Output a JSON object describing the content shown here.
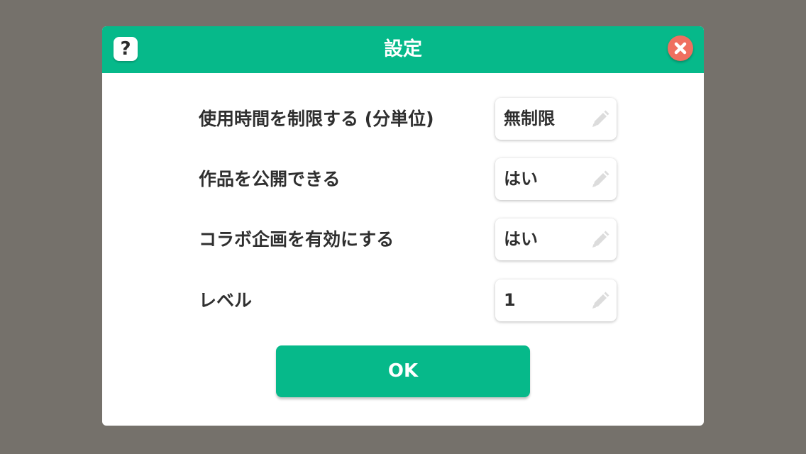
{
  "dialog": {
    "title": "設定",
    "help_label": "?",
    "ok_label": "OK"
  },
  "settings": [
    {
      "label": "使用時間を制限する (分単位)",
      "value": "無制限"
    },
    {
      "label": "作品を公開できる",
      "value": "はい"
    },
    {
      "label": "コラボ企画を有効にする",
      "value": "はい"
    },
    {
      "label": "レベル",
      "value": "1"
    }
  ],
  "icons": {
    "help": "question-icon",
    "close": "close-icon",
    "edit": "pencil-icon"
  },
  "colors": {
    "accent": "#06b98a",
    "close": "#ef6f60",
    "backdrop": "#75716b"
  }
}
